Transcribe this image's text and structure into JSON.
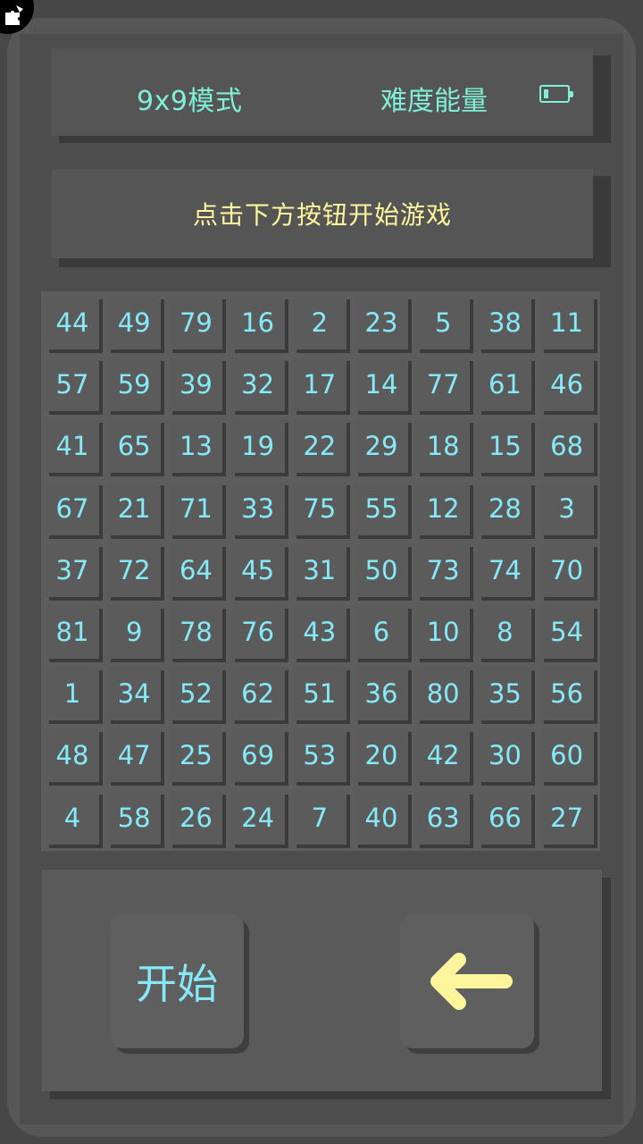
{
  "header": {
    "mode_label": "9x9模式",
    "difficulty_label": "难度能量",
    "energy_level": 0.2
  },
  "message": "点击下方按钮开始游戏",
  "board": [
    [
      44,
      49,
      79,
      16,
      2,
      23,
      5,
      38,
      11
    ],
    [
      57,
      59,
      39,
      32,
      17,
      14,
      77,
      61,
      46
    ],
    [
      41,
      65,
      13,
      19,
      22,
      29,
      18,
      15,
      68
    ],
    [
      67,
      21,
      71,
      33,
      75,
      55,
      12,
      28,
      3
    ],
    [
      37,
      72,
      64,
      45,
      31,
      50,
      73,
      74,
      70
    ],
    [
      81,
      9,
      78,
      76,
      43,
      6,
      10,
      8,
      54
    ],
    [
      1,
      34,
      52,
      62,
      51,
      36,
      80,
      35,
      56
    ],
    [
      48,
      47,
      25,
      69,
      53,
      20,
      42,
      30,
      60
    ],
    [
      4,
      58,
      26,
      24,
      7,
      40,
      63,
      66,
      27
    ]
  ],
  "controls": {
    "start_label": "开始",
    "back_icon": "arrow-left-icon"
  },
  "colors": {
    "tile_text": "#86e9f7",
    "header_text": "#7ff0d6",
    "message_text": "#fff59d",
    "arrow": "#fff59d"
  }
}
